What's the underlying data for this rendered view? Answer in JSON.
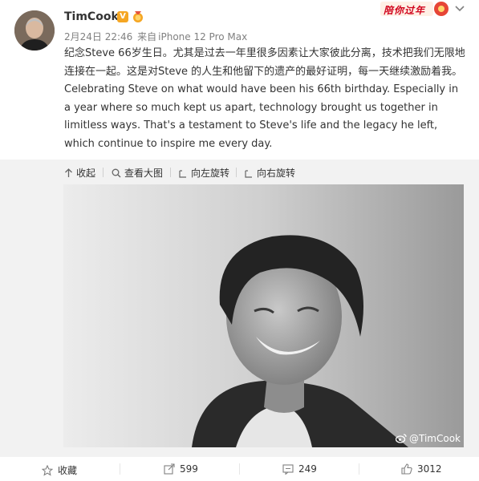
{
  "post": {
    "username": "TimCook",
    "verified_mark": "V",
    "meta": {
      "date": "2月24日 22:46",
      "source_prefix": "来自",
      "device": "iPhone 12 Pro Max"
    },
    "text": "纪念Steve 66岁生日。尤其是过去一年里很多因素让大家彼此分离，技术把我们无限地连接在一起。这是对Steve 的人生和他留下的遗产的最好证明，每一天继续激励着我。Celebrating Steve on what would have been his 66th birthday. Especially in a year where so much kept us apart, technology brought us together in limitless ways. That's a testament to Steve's life and the legacy he left, which continue to inspire me every day.",
    "promo_label": "陪你过年"
  },
  "image_toolbar": {
    "collapse": "收起",
    "view_large": "查看大图",
    "rotate_left": "向左旋转",
    "rotate_right": "向右旋转"
  },
  "photo": {
    "watermark": "@TimCook"
  },
  "footer": {
    "favorite": "收藏",
    "reposts": "599",
    "comments": "249",
    "likes": "3012"
  },
  "colors": {
    "verified_badge": "#f5a623",
    "promo_red": "#d0021b",
    "toolbar_bg": "#f2f2f2"
  },
  "icons": [
    "medal-icon",
    "chevron-down-icon",
    "collapse-icon",
    "zoom-icon",
    "rotate-left-icon",
    "rotate-right-icon",
    "weibo-logo-icon",
    "star-icon",
    "share-icon",
    "comment-icon",
    "thumbs-up-icon"
  ]
}
